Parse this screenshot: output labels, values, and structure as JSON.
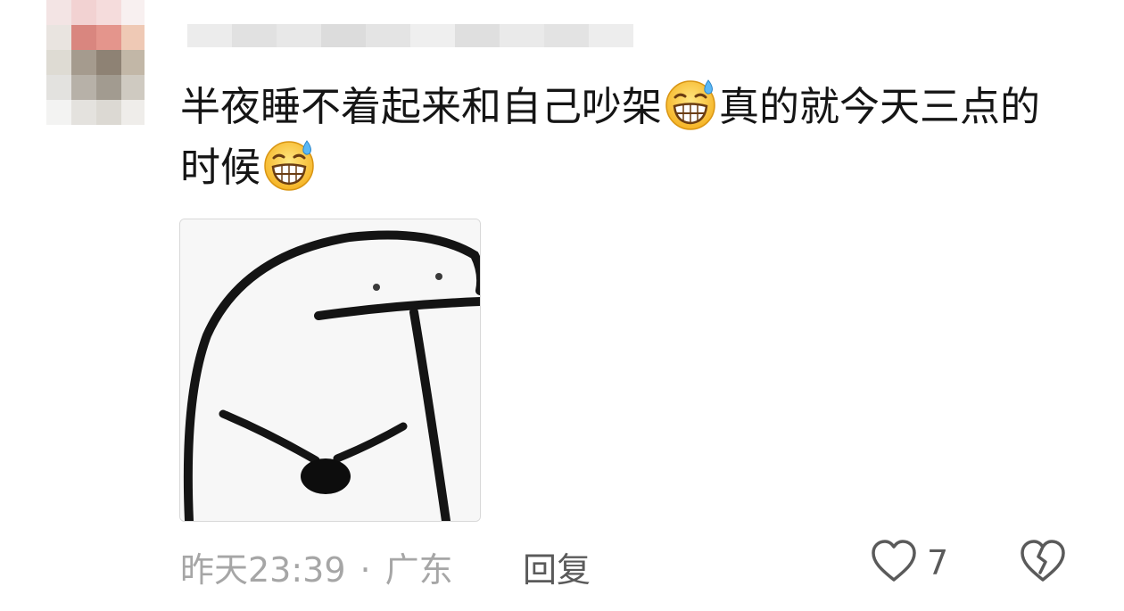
{
  "comment": {
    "text_part1": "半夜睡不着起来和自己吵架",
    "text_part2": "真的就今天三点的时候",
    "emoji_icon": "grinning-sweat-icon",
    "image_alt": "meme-sticker"
  },
  "footer": {
    "time": "昨天23:39",
    "separator": "·",
    "location": "广东",
    "reply_label": "回复",
    "like_count": "7"
  },
  "colors": {
    "text": "#151515",
    "meta": "#a6a6a6",
    "action": "#5a5a5a"
  }
}
